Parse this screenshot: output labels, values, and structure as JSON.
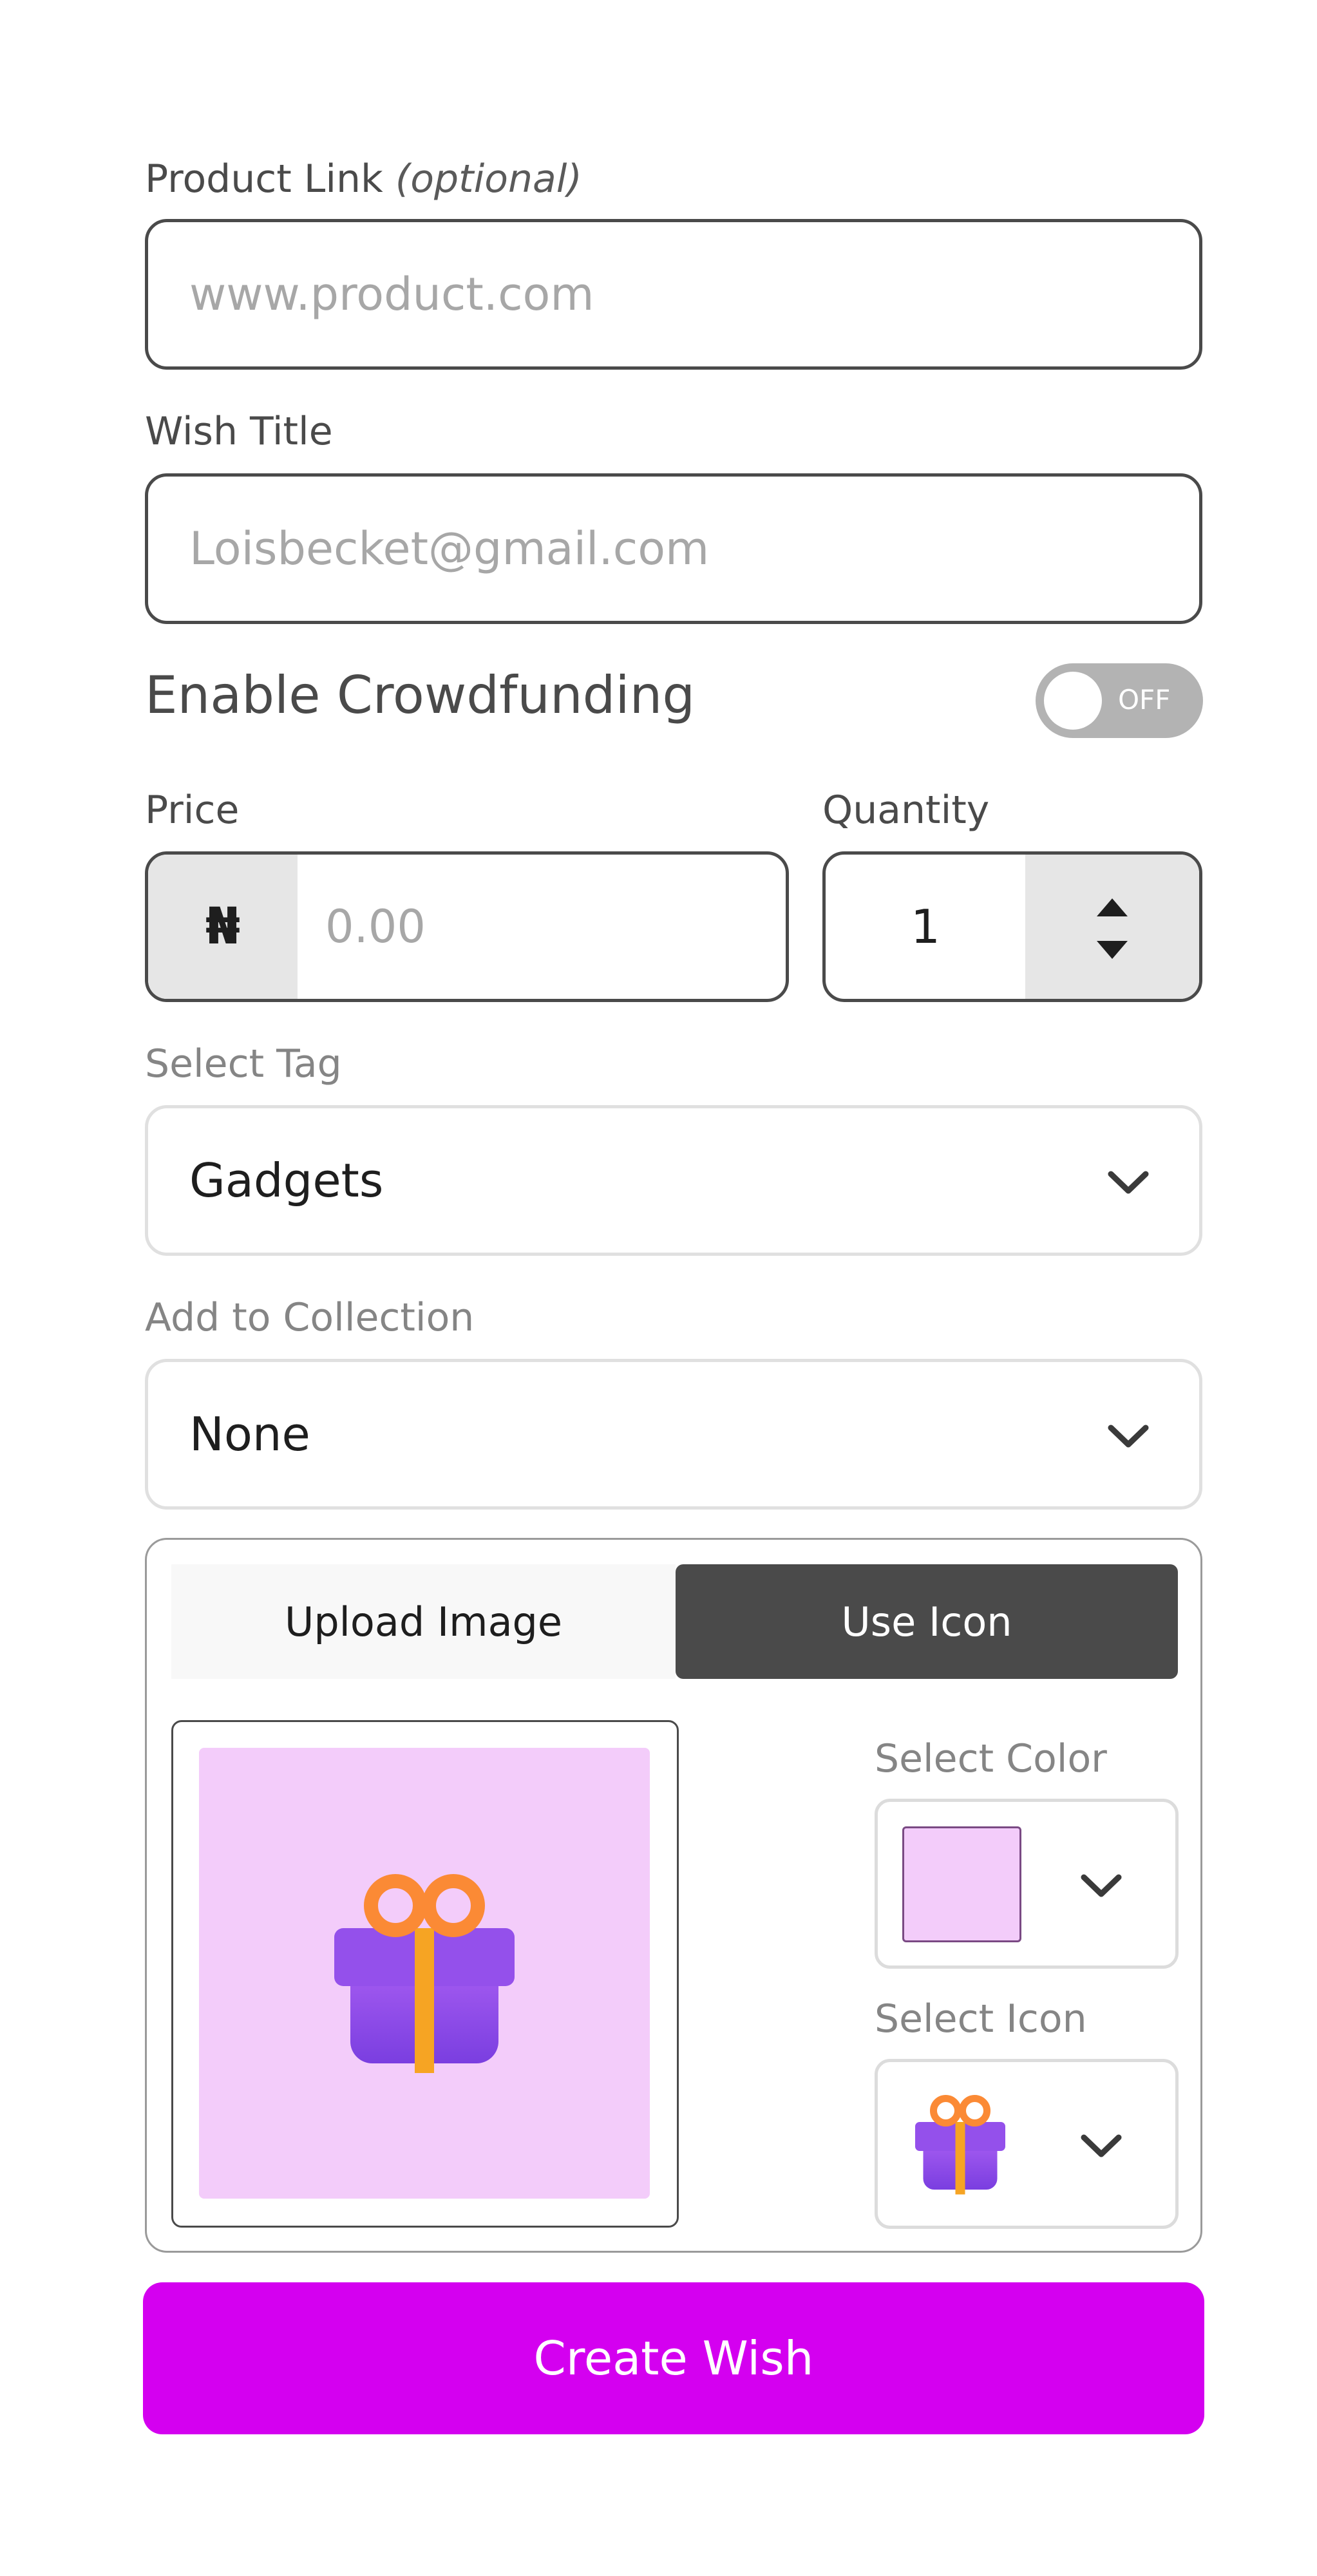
{
  "product_link": {
    "label": "Product Link",
    "label_note": "(optional)",
    "placeholder": "www.product.com"
  },
  "wish_title": {
    "label": "Wish Title",
    "placeholder": "Loisbecket@gmail.com"
  },
  "crowdfunding": {
    "label": "Enable Crowdfunding",
    "toggle_text": "OFF",
    "enabled": false
  },
  "price": {
    "label": "Price",
    "currency_symbol": "₦",
    "placeholder": "0.00"
  },
  "quantity": {
    "label": "Quantity",
    "value": "1"
  },
  "tag": {
    "label": "Select Tag",
    "selected": "Gadgets"
  },
  "collection": {
    "label": "Add to Collection",
    "selected": "None"
  },
  "media": {
    "tabs": [
      {
        "label": "Upload Image",
        "active": false
      },
      {
        "label": "Use Icon",
        "active": true
      }
    ],
    "preview_icon": "gift-icon",
    "color_label": "Select Color",
    "selected_color": "#f3ccfa",
    "icon_label": "Select Icon",
    "selected_icon": "gift-icon"
  },
  "submit": {
    "label": "Create Wish"
  },
  "colors": {
    "accent": "#d400f0",
    "active_tab": "#4a4a4a",
    "toggle_off": "#b3b3b3"
  }
}
